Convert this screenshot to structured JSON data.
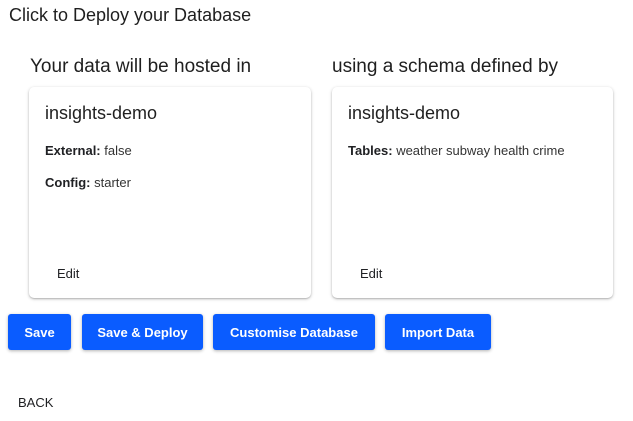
{
  "page": {
    "title": "Click to Deploy your Database"
  },
  "left_section": {
    "heading": "Your data will be hosted in",
    "card": {
      "title": "insights-demo",
      "rows": [
        {
          "key": "External:",
          "value": "false"
        },
        {
          "key": "Config:",
          "value": "starter"
        }
      ],
      "edit_label": "Edit"
    }
  },
  "right_section": {
    "heading": "using a schema defined by",
    "card": {
      "title": "insights-demo",
      "rows": [
        {
          "key": "Tables:",
          "value": "weather subway health crime"
        }
      ],
      "edit_label": "Edit"
    }
  },
  "actions": {
    "save_label": "Save",
    "save_deploy_label": "Save & Deploy",
    "customise_label": "Customise Database",
    "import_label": "Import Data"
  },
  "nav": {
    "back_label": "BACK"
  },
  "colors": {
    "primary": "#0a5cff",
    "text": "#202124"
  }
}
